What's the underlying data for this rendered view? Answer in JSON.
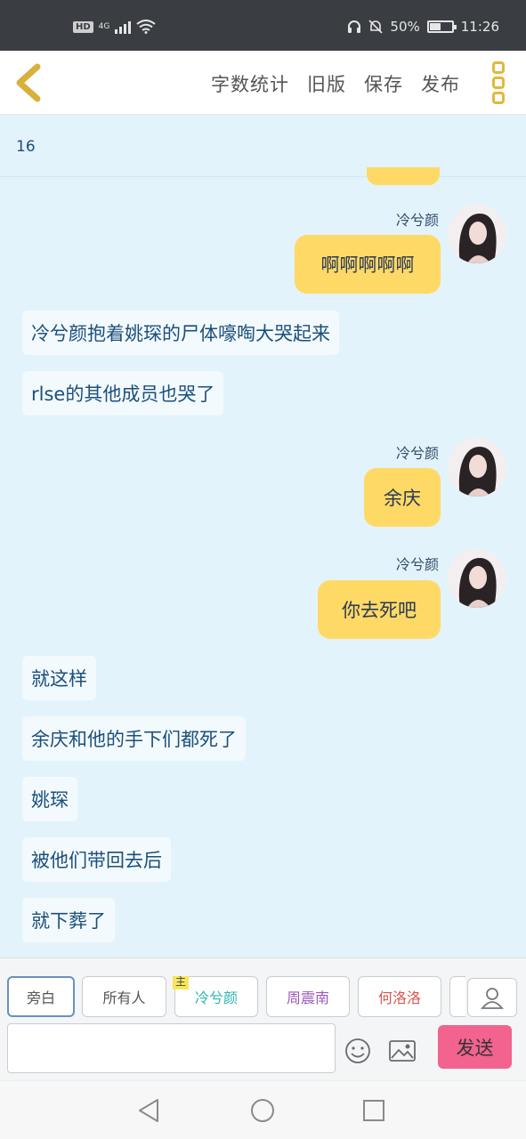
{
  "status_bar": {
    "hd": "HD",
    "network": "4G",
    "battery": "50%",
    "time": "11:26"
  },
  "header": {
    "actions": [
      "字数统计",
      "旧版",
      "保存",
      "发布"
    ]
  },
  "chat": {
    "counter": "16",
    "messages": [
      {
        "type": "right",
        "name": "冷兮颜",
        "text": "啊啊啊啊啊"
      },
      {
        "type": "narration",
        "text": "冷兮颜抱着姚琛的尸体嚎啕大哭起来"
      },
      {
        "type": "narration",
        "text": "rlse的其他成员也哭了"
      },
      {
        "type": "right",
        "name": "冷兮颜",
        "text": "余庆"
      },
      {
        "type": "right",
        "name": "冷兮颜",
        "text": "你去死吧"
      },
      {
        "type": "narration",
        "text": "就这样"
      },
      {
        "type": "narration",
        "text": "余庆和他的手下们都死了"
      },
      {
        "type": "narration",
        "text": "姚琛"
      },
      {
        "type": "narration",
        "text": "被他们带回去后"
      },
      {
        "type": "narration",
        "text": "就下葬了"
      }
    ]
  },
  "composer": {
    "roles": [
      {
        "label": "旁白",
        "color": "#555555"
      },
      {
        "label": "所有人",
        "color": "#555555"
      },
      {
        "label": "冷兮颜",
        "color": "#2bb5b0",
        "tag": "主"
      },
      {
        "label": "周震南",
        "color": "#9b59b6"
      },
      {
        "label": "何洛洛",
        "color": "#d9534f"
      }
    ],
    "input_value": "",
    "send_label": "发送"
  },
  "colors": {
    "accent_yellow": "#ffd966",
    "send_pink": "#f2638f",
    "chat_bg": "#e3f3fb"
  }
}
